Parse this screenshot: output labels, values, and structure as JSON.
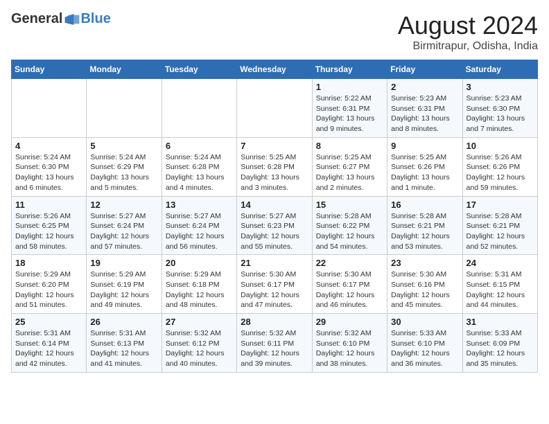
{
  "logo": {
    "general": "General",
    "blue": "Blue"
  },
  "title": "August 2024",
  "subtitle": "Birmitrapur, Odisha, India",
  "days_of_week": [
    "Sunday",
    "Monday",
    "Tuesday",
    "Wednesday",
    "Thursday",
    "Friday",
    "Saturday"
  ],
  "weeks": [
    [
      {
        "day": "",
        "info": ""
      },
      {
        "day": "",
        "info": ""
      },
      {
        "day": "",
        "info": ""
      },
      {
        "day": "",
        "info": ""
      },
      {
        "day": "1",
        "info": "Sunrise: 5:22 AM\nSunset: 6:31 PM\nDaylight: 13 hours and 9 minutes."
      },
      {
        "day": "2",
        "info": "Sunrise: 5:23 AM\nSunset: 6:31 PM\nDaylight: 13 hours and 8 minutes."
      },
      {
        "day": "3",
        "info": "Sunrise: 5:23 AM\nSunset: 6:30 PM\nDaylight: 13 hours and 7 minutes."
      }
    ],
    [
      {
        "day": "4",
        "info": "Sunrise: 5:24 AM\nSunset: 6:30 PM\nDaylight: 13 hours and 6 minutes."
      },
      {
        "day": "5",
        "info": "Sunrise: 5:24 AM\nSunset: 6:29 PM\nDaylight: 13 hours and 5 minutes."
      },
      {
        "day": "6",
        "info": "Sunrise: 5:24 AM\nSunset: 6:28 PM\nDaylight: 13 hours and 4 minutes."
      },
      {
        "day": "7",
        "info": "Sunrise: 5:25 AM\nSunset: 6:28 PM\nDaylight: 13 hours and 3 minutes."
      },
      {
        "day": "8",
        "info": "Sunrise: 5:25 AM\nSunset: 6:27 PM\nDaylight: 13 hours and 2 minutes."
      },
      {
        "day": "9",
        "info": "Sunrise: 5:25 AM\nSunset: 6:26 PM\nDaylight: 13 hours and 1 minute."
      },
      {
        "day": "10",
        "info": "Sunrise: 5:26 AM\nSunset: 6:26 PM\nDaylight: 12 hours and 59 minutes."
      }
    ],
    [
      {
        "day": "11",
        "info": "Sunrise: 5:26 AM\nSunset: 6:25 PM\nDaylight: 12 hours and 58 minutes."
      },
      {
        "day": "12",
        "info": "Sunrise: 5:27 AM\nSunset: 6:24 PM\nDaylight: 12 hours and 57 minutes."
      },
      {
        "day": "13",
        "info": "Sunrise: 5:27 AM\nSunset: 6:24 PM\nDaylight: 12 hours and 56 minutes."
      },
      {
        "day": "14",
        "info": "Sunrise: 5:27 AM\nSunset: 6:23 PM\nDaylight: 12 hours and 55 minutes."
      },
      {
        "day": "15",
        "info": "Sunrise: 5:28 AM\nSunset: 6:22 PM\nDaylight: 12 hours and 54 minutes."
      },
      {
        "day": "16",
        "info": "Sunrise: 5:28 AM\nSunset: 6:21 PM\nDaylight: 12 hours and 53 minutes."
      },
      {
        "day": "17",
        "info": "Sunrise: 5:28 AM\nSunset: 6:21 PM\nDaylight: 12 hours and 52 minutes."
      }
    ],
    [
      {
        "day": "18",
        "info": "Sunrise: 5:29 AM\nSunset: 6:20 PM\nDaylight: 12 hours and 51 minutes."
      },
      {
        "day": "19",
        "info": "Sunrise: 5:29 AM\nSunset: 6:19 PM\nDaylight: 12 hours and 49 minutes."
      },
      {
        "day": "20",
        "info": "Sunrise: 5:29 AM\nSunset: 6:18 PM\nDaylight: 12 hours and 48 minutes."
      },
      {
        "day": "21",
        "info": "Sunrise: 5:30 AM\nSunset: 6:17 PM\nDaylight: 12 hours and 47 minutes."
      },
      {
        "day": "22",
        "info": "Sunrise: 5:30 AM\nSunset: 6:17 PM\nDaylight: 12 hours and 46 minutes."
      },
      {
        "day": "23",
        "info": "Sunrise: 5:30 AM\nSunset: 6:16 PM\nDaylight: 12 hours and 45 minutes."
      },
      {
        "day": "24",
        "info": "Sunrise: 5:31 AM\nSunset: 6:15 PM\nDaylight: 12 hours and 44 minutes."
      }
    ],
    [
      {
        "day": "25",
        "info": "Sunrise: 5:31 AM\nSunset: 6:14 PM\nDaylight: 12 hours and 42 minutes."
      },
      {
        "day": "26",
        "info": "Sunrise: 5:31 AM\nSunset: 6:13 PM\nDaylight: 12 hours and 41 minutes."
      },
      {
        "day": "27",
        "info": "Sunrise: 5:32 AM\nSunset: 6:12 PM\nDaylight: 12 hours and 40 minutes."
      },
      {
        "day": "28",
        "info": "Sunrise: 5:32 AM\nSunset: 6:11 PM\nDaylight: 12 hours and 39 minutes."
      },
      {
        "day": "29",
        "info": "Sunrise: 5:32 AM\nSunset: 6:10 PM\nDaylight: 12 hours and 38 minutes."
      },
      {
        "day": "30",
        "info": "Sunrise: 5:33 AM\nSunset: 6:10 PM\nDaylight: 12 hours and 36 minutes."
      },
      {
        "day": "31",
        "info": "Sunrise: 5:33 AM\nSunset: 6:09 PM\nDaylight: 12 hours and 35 minutes."
      }
    ]
  ]
}
